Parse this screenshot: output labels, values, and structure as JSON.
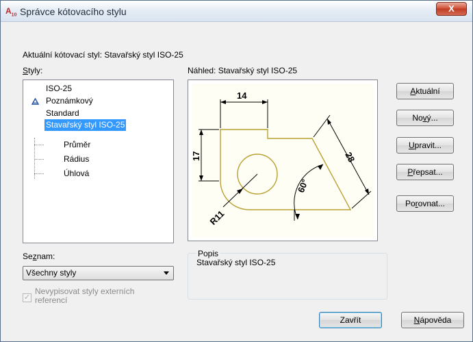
{
  "window": {
    "title": "Správce kótovacího stylu",
    "icon_text": "A",
    "icon_sub": "10",
    "close_label": "X"
  },
  "current_style_label": "Aktuální kótovací styl: Stavařský styl ISO-25",
  "styles": {
    "label_prefix": "",
    "label_accel": "S",
    "label_rest": "tyly:",
    "items": [
      {
        "label": "ISO-25",
        "annotative": false
      },
      {
        "label": "Poznámkový",
        "annotative": true
      },
      {
        "label": "Standard",
        "annotative": false
      },
      {
        "label": "Stavařský styl ISO-25",
        "annotative": false,
        "selected": true
      },
      {
        "label": "Průměr",
        "child": true
      },
      {
        "label": "Rádius",
        "child": true
      },
      {
        "label": "Úhlová",
        "child": true
      }
    ]
  },
  "preview": {
    "label": "Náhled: Stavařský styl ISO-25",
    "dims": {
      "width": "14",
      "height": "17",
      "slant": "28",
      "angle": "60°",
      "radius": "R11"
    }
  },
  "buttons": {
    "current_accel": "A",
    "current_rest": "ktuální",
    "new_pre": "No",
    "new_accel": "v",
    "new_rest": "ý...",
    "edit_accel": "U",
    "edit_rest": "pravit...",
    "override_pre": "",
    "override_accel": "P",
    "override_rest": "řepsat...",
    "compare_pre": "Po",
    "compare_accel": "r",
    "compare_rest": "ovnat...",
    "close_label": "Zavřít",
    "help_accel": "N",
    "help_rest": "ápověda"
  },
  "list_filter": {
    "label_pre": "Se",
    "label_accel": "z",
    "label_rest": "nam:",
    "selected": "Všechny styly"
  },
  "xref_checkbox": {
    "line1": "Nevypisovat styly externích",
    "line2": "referencí",
    "checked": true,
    "check_glyph": "✓"
  },
  "description": {
    "label": "Popis",
    "text": "Stavařský styl ISO-25"
  },
  "colors": {
    "selection": "#3399ff",
    "geometry": "#b8a030",
    "dim_lines": "#000000"
  }
}
